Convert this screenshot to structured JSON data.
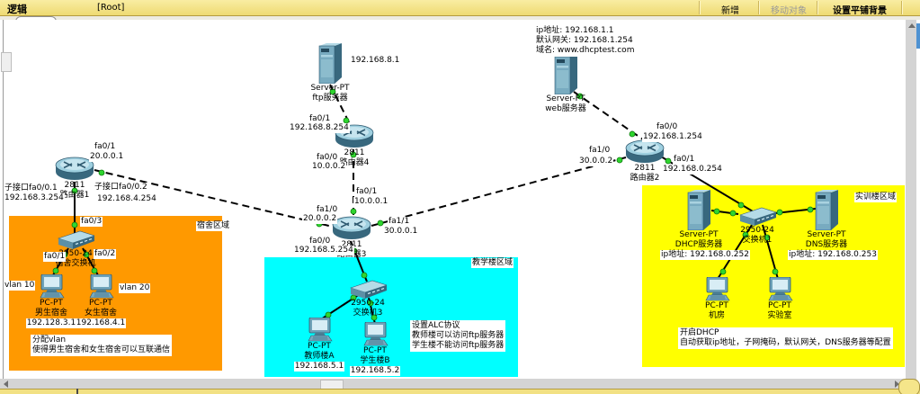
{
  "window": {
    "workspace_tab": "逻辑",
    "root_label": "[Root]",
    "buttons": {
      "new": "新增",
      "move_object": "移动对象",
      "set_background": "设置平铺背景"
    }
  },
  "colors": {
    "titlebar": "#F2E184",
    "region_dorm": "#FF9900",
    "region_teaching": "#00FFFF",
    "region_training": "#FFFF00",
    "link_up_indicator": "#2FD52F"
  },
  "regions": {
    "dorm": {
      "title": "宿舍区域",
      "notes": [
        "分配vlan",
        "使得男生宿舍和女生宿舍可以互联通信"
      ]
    },
    "teaching": {
      "title": "教学楼区域",
      "notes": [
        "设置ALC协议",
        "教师楼可以访问ftp服务器",
        "学生楼不能访问ftp服务器"
      ]
    },
    "training": {
      "title": "实训楼区域",
      "notes": [
        "开启DHCP",
        "自动获取ip地址，子网掩码，默认网关，DNS服务器等配置"
      ]
    }
  },
  "devices": {
    "ftp_server": {
      "model": "Server-PT",
      "name": "ftp服务器",
      "ip": "192.168.8.1"
    },
    "web_server": {
      "model": "Server-PT",
      "name": "web服务器",
      "info": [
        "ip地址: 192.168.1.1",
        "默认网关: 192.168.1.254",
        "域名: www.dhcptest.com"
      ]
    },
    "router1": {
      "model": "2811",
      "name": "路由器1"
    },
    "router2": {
      "model": "2811",
      "name": "路由器2"
    },
    "router3": {
      "model": "2811",
      "name": "路由器3"
    },
    "router4": {
      "model": "2811",
      "name": "路由器4"
    },
    "dorm_switch": {
      "model": "2950-24",
      "name": "宿舍交换机"
    },
    "teach_switch": {
      "model": "2950-24",
      "name": "交换机3"
    },
    "train_switch": {
      "model": "2950-24",
      "name": "交换机1"
    },
    "dhcp_server": {
      "model": "Server-PT",
      "name": "DHCP服务器",
      "ip": "ip地址: 192.168.0.252"
    },
    "dns_server": {
      "model": "Server-PT",
      "name": "DNS服务器",
      "ip": "ip地址: 192.168.0.253"
    },
    "pc_boys": {
      "model": "PC-PT",
      "name": "男生宿舍",
      "ip": "192.128.3.1",
      "vlan": "vlan 10"
    },
    "pc_girls": {
      "model": "PC-PT",
      "name": "女生宿舍",
      "ip": "192.168.4.1",
      "vlan": "vlan 20"
    },
    "pc_teacher": {
      "model": "PC-PT",
      "name": "教师楼A",
      "ip": "192.168.5.1"
    },
    "pc_student": {
      "model": "PC-PT",
      "name": "学生楼B",
      "ip": "192.168.5.2"
    },
    "pc_room": {
      "model": "PC-PT",
      "name": "机房"
    },
    "pc_lab": {
      "model": "PC-PT",
      "name": "实验室"
    }
  },
  "ports": {
    "r1_fa01": "fa0/1",
    "r1_fa01_ip": "20.0.0.1",
    "r1_sub1": "子接口fa0/0.1",
    "r1_sub1_ip": "192.168.3.254",
    "r1_sub2": "子接口fa0/0.2",
    "r1_sub2_ip": "192.168.4.254",
    "r4_fa01": "fa0/1",
    "r4_fa01_ip": "192.168.8.254",
    "r4_fa00": "fa0/0",
    "r4_fa00_ip": "10.0.0.2",
    "r3_fa01": "fa0/1",
    "r3_fa01_ip": "10.0.0.1",
    "r3_fa10": "fa1/0",
    "r3_fa10_ip": "20.0.0.2",
    "r3_fa11": "fa1/1",
    "r3_fa11_ip": "30.0.0.1",
    "r3_fa00": "fa0/0",
    "r3_fa00_ip": "192.168.5.254",
    "r2_fa10": "fa1/0",
    "r2_fa10_ip": "30.0.0.2",
    "r2_fa00": "fa0/0",
    "r2_fa00_ip": "192.168.1.254",
    "r2_fa01": "fa0/1",
    "r2_fa01_ip": "192.168.0.254",
    "dorm_fa03": "fa0/3",
    "dorm_fa01": "fa0/1",
    "dorm_fa02": "fa0/2"
  }
}
